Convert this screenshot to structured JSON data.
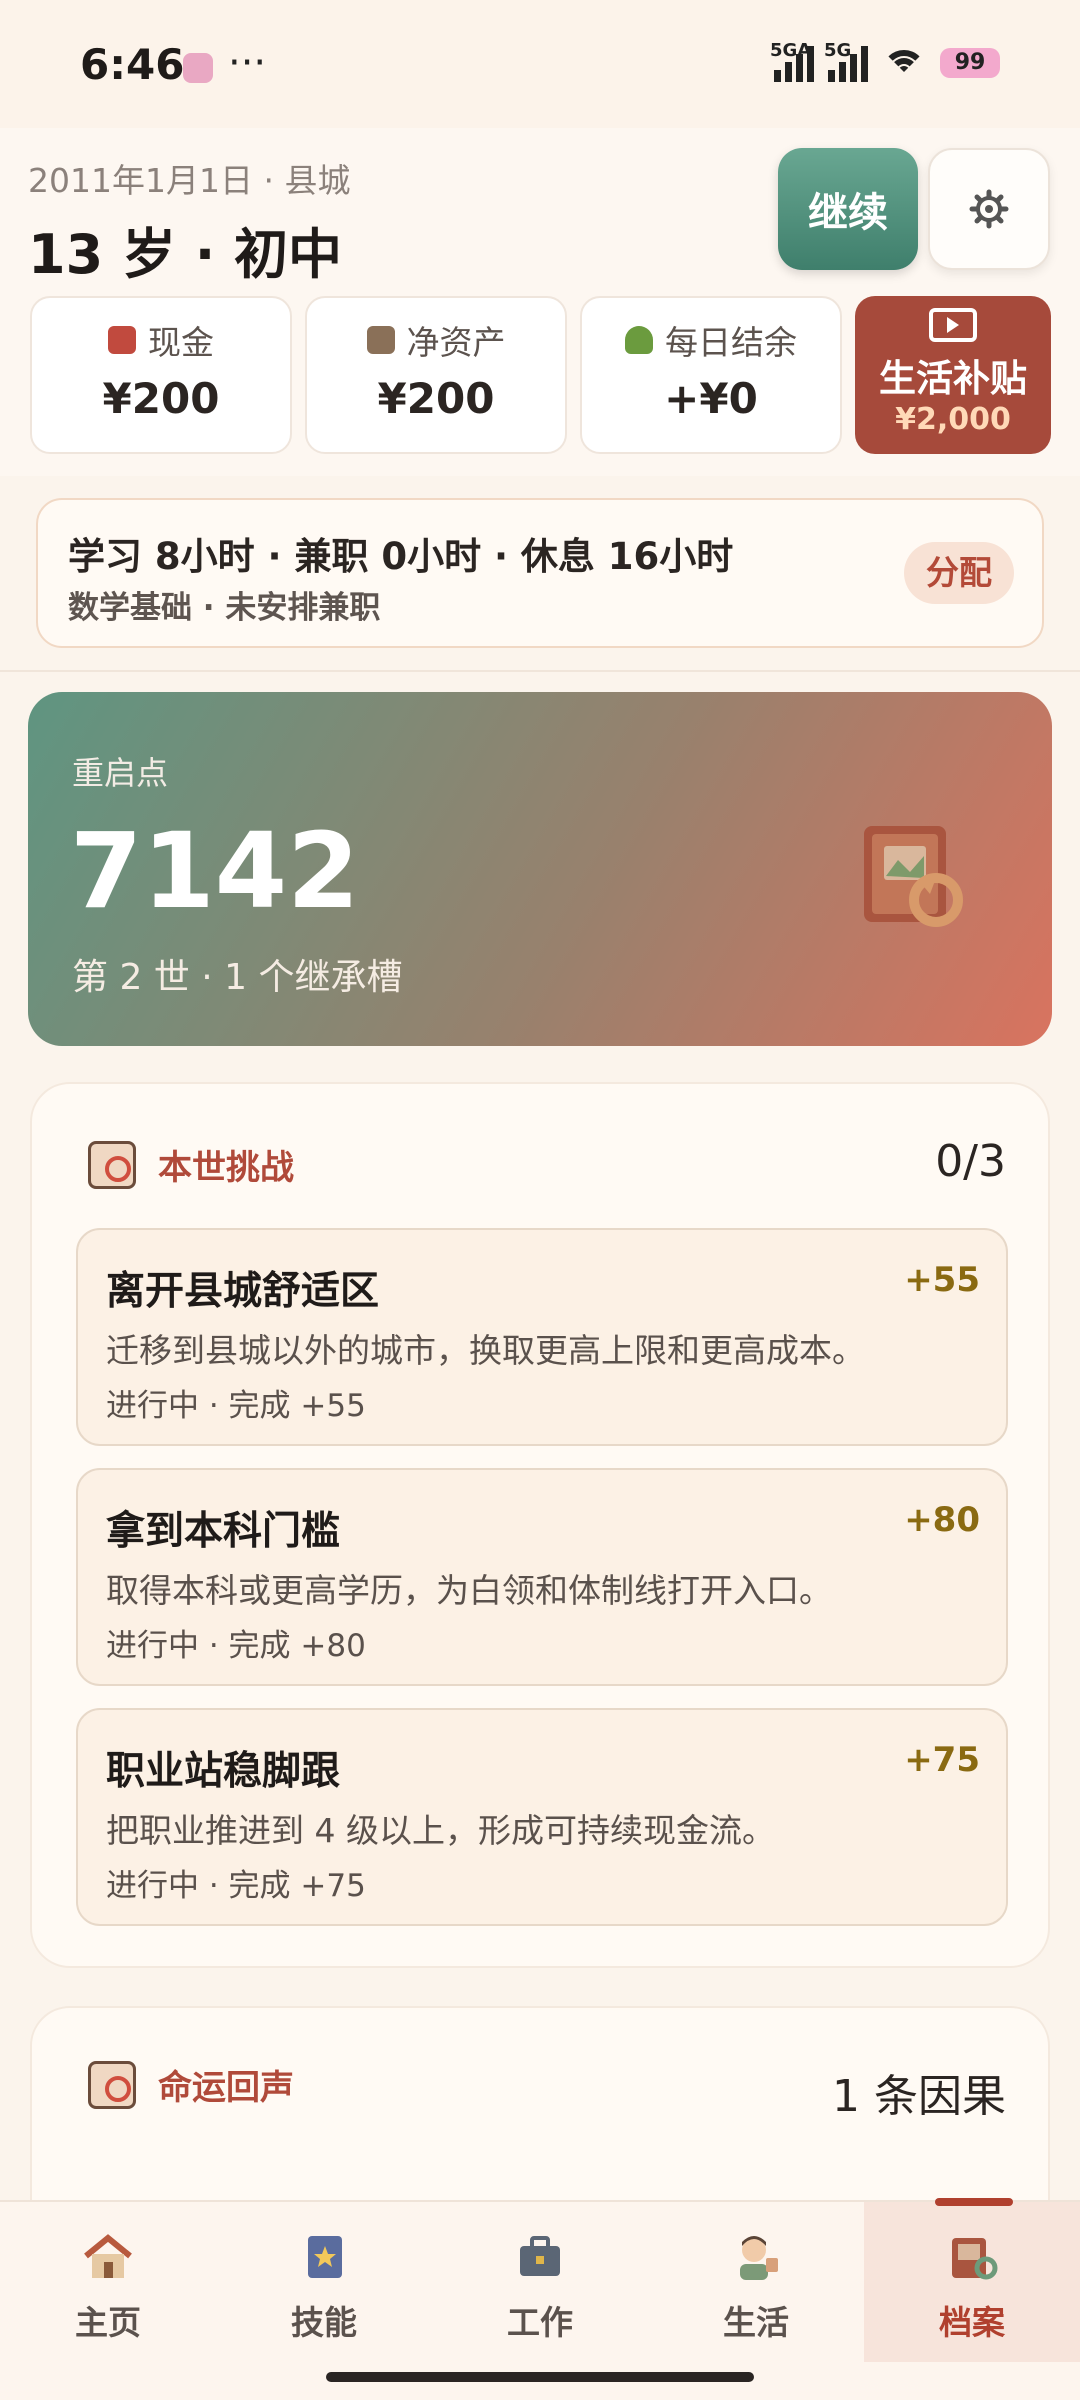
{
  "status_bar": {
    "time": "6:46",
    "signal1_label": "5GA",
    "signal2_label": "5G",
    "battery": "99"
  },
  "header": {
    "date_location": "2011年1月1日 · 县城",
    "age_stage": "13 岁 · 初中",
    "continue_label": "继续",
    "settings_icon": "gear-icon"
  },
  "stats": [
    {
      "label": "现金",
      "value": "¥200",
      "icon": "cash-icon",
      "color": "#c14a3e"
    },
    {
      "label": "净资产",
      "value": "¥200",
      "icon": "building-icon",
      "color": "#8a7058"
    },
    {
      "label": "每日结余",
      "value": "+¥0",
      "icon": "sprout-icon",
      "color": "#6b9b3e"
    }
  ],
  "subsidy": {
    "label": "生活补贴",
    "amount": "¥2,000",
    "icon": "video-icon"
  },
  "schedule": {
    "summary": "学习 8小时 · 兼职 0小时 · 休息 16小时",
    "detail": "数学基础 · 未安排兼职",
    "allocate_label": "分配"
  },
  "restart": {
    "label": "重启点",
    "points": "7142",
    "subtitle": "第 2 世 · 1 个继承槽"
  },
  "challenges": {
    "title": "本世挑战",
    "count": "0/3",
    "items": [
      {
        "title": "离开县城舒适区",
        "points": "+55",
        "desc": "迁移到县城以外的城市，换取更高上限和更高成本。",
        "status": "进行中 · 完成 +55"
      },
      {
        "title": "拿到本科门槛",
        "points": "+80",
        "desc": "取得本科或更高学历，为白领和体制线打开入口。",
        "status": "进行中 · 完成 +80"
      },
      {
        "title": "职业站稳脚跟",
        "points": "+75",
        "desc": "把职业推进到 4 级以上，形成可持续现金流。",
        "status": "进行中 · 完成 +75"
      }
    ]
  },
  "fate": {
    "title": "命运回声",
    "count": "1 条因果"
  },
  "tabs": [
    {
      "label": "主页",
      "icon": "home-icon"
    },
    {
      "label": "技能",
      "icon": "skill-book-icon"
    },
    {
      "label": "工作",
      "icon": "briefcase-icon"
    },
    {
      "label": "生活",
      "icon": "person-icon"
    },
    {
      "label": "档案",
      "icon": "archive-icon"
    }
  ],
  "active_tab": "档案"
}
